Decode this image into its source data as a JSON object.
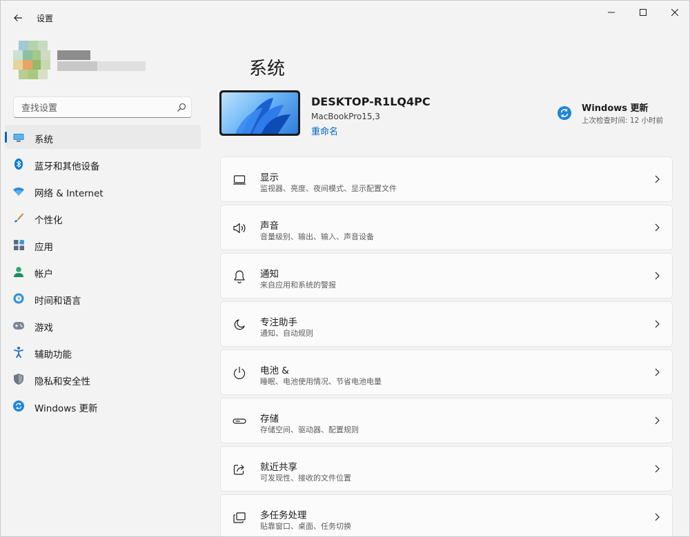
{
  "app": {
    "title": "设置"
  },
  "search": {
    "placeholder": "查找设置"
  },
  "sidebar": {
    "items": [
      {
        "label": "系统",
        "icon": "monitor-icon",
        "selected": true
      },
      {
        "label": "蓝牙和其他设备",
        "icon": "bluetooth-icon"
      },
      {
        "label": "网络 & Internet",
        "icon": "wifi-icon"
      },
      {
        "label": "个性化",
        "icon": "brush-icon"
      },
      {
        "label": "应用",
        "icon": "apps-icon"
      },
      {
        "label": "帐户",
        "icon": "person-icon"
      },
      {
        "label": "时间和语言",
        "icon": "globe-clock-icon"
      },
      {
        "label": "游戏",
        "icon": "gamepad-icon"
      },
      {
        "label": "辅助功能",
        "icon": "accessibility-icon"
      },
      {
        "label": "隐私和安全性",
        "icon": "shield-icon"
      },
      {
        "label": "Windows 更新",
        "icon": "windows-update-icon"
      }
    ]
  },
  "main": {
    "title": "系统",
    "device": {
      "name": "DESKTOP-R1LQ4PC",
      "model": "MacBookPro15,3",
      "rename_label": "重命名"
    },
    "update": {
      "title": "Windows 更新",
      "subtitle": "上次检查时间: 12 小时前"
    },
    "settings": [
      {
        "title": "显示",
        "subtitle": "监视器、亮度、夜间模式、显示配置文件",
        "icon": "display-icon"
      },
      {
        "title": "声音",
        "subtitle": "音量级别、输出、输入、声音设备",
        "icon": "speaker-icon"
      },
      {
        "title": "通知",
        "subtitle": "来自应用和系统的警报",
        "icon": "bell-icon"
      },
      {
        "title": "专注助手",
        "subtitle": "通知、自动规则",
        "icon": "moon-icon"
      },
      {
        "title": "电池 &",
        "subtitle": "睡眠、电池使用情况、节省电池电量",
        "icon": "power-icon"
      },
      {
        "title": "存储",
        "subtitle": "存储空间、驱动器、配置规则",
        "icon": "storage-icon"
      },
      {
        "title": "就近共享",
        "subtitle": "可发现性、接收的文件位置",
        "icon": "share-icon"
      },
      {
        "title": "多任务处理",
        "subtitle": "贴靠窗口、桌面、任务切换",
        "icon": "multitask-icon"
      }
    ]
  },
  "colors": {
    "accent": "#0067c0",
    "background": "#f3f3f3",
    "card": "#fbfbfb"
  }
}
